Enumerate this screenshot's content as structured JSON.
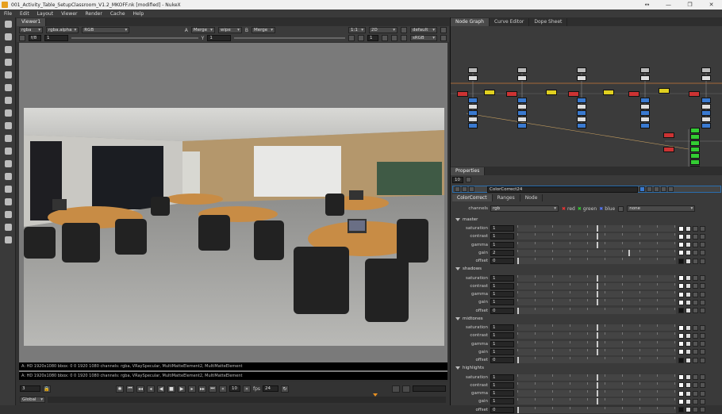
{
  "window": {
    "title": "001_Activity_Table_SetupClassroom_V1.2_MKOFF.nk [modified] - NukeX",
    "controls": [
      "↔",
      "—",
      "❐",
      "✕"
    ]
  },
  "menu": [
    "File",
    "Edit",
    "Layout",
    "Viewer",
    "Render",
    "Cache",
    "Help"
  ],
  "left_tools": [
    "viewer-icon",
    "paint-icon",
    "time-icon",
    "channel-icon",
    "color-icon",
    "filter-icon",
    "keyer-icon",
    "merge-icon",
    "transform-icon",
    "3d-icon",
    "particles-icon",
    "deep-icon",
    "views-icon",
    "metadata-icon",
    "toolsets-icon",
    "other-icon",
    "cara-icon",
    "smartvector-icon"
  ],
  "viewer": {
    "tab": "Viewer1",
    "bar1": {
      "channels": "rgba",
      "alpha": "rgba.alpha",
      "display": "RGB",
      "a_label": "A",
      "a_merge": "Merge",
      "wipe": "wipe",
      "b_label": "B",
      "b_merge": "Merge"
    },
    "bar1_right": {
      "zoom": "1:1",
      "mode": "2D",
      "view": "default"
    },
    "bar2": {
      "fstop": "f/8",
      "fstop_val": "1",
      "y_label": "Y",
      "gamma": "1"
    },
    "bar2_right": {
      "proxy": "1",
      "lut": "sRGB"
    },
    "info1": "A: HD 1920x1080 bbox: 0 0 1920 1080 channels: rgba, VRaySpecular, MultiMatteElement2, MultiMatteElement",
    "info2": "A: HD 1920x1080 bbox: 0 0 1920 1080 channels: rgba, VRaySpecular, MultiMatteElement2, MultiMatteElement",
    "frame": "3",
    "fps_label": "fps",
    "fps": "24",
    "step": "10",
    "range": "Global"
  },
  "nodegraph": {
    "tabs": [
      "Node Graph",
      "Curve Editor",
      "Dope Sheet"
    ]
  },
  "properties": {
    "tab": "Properties",
    "count": "10",
    "node_name": "ColorCorrect24",
    "subtabs": [
      "ColorCorrect",
      "Ranges",
      "Node"
    ],
    "channels_label": "channels",
    "channels_val": "rgb",
    "ch_red": "red",
    "ch_green": "green",
    "ch_blue": "blue",
    "ch_none": "none",
    "sections": [
      {
        "name": "master",
        "rows": [
          {
            "label": "saturation",
            "value": "1"
          },
          {
            "label": "contrast",
            "value": "1"
          },
          {
            "label": "gamma",
            "value": "1"
          },
          {
            "label": "gain",
            "value": "2"
          },
          {
            "label": "offset",
            "value": "0"
          }
        ]
      },
      {
        "name": "shadows",
        "rows": [
          {
            "label": "saturation",
            "value": "1"
          },
          {
            "label": "contrast",
            "value": "1"
          },
          {
            "label": "gamma",
            "value": "1"
          },
          {
            "label": "gain",
            "value": "1"
          },
          {
            "label": "offset",
            "value": "0"
          }
        ]
      },
      {
        "name": "midtones",
        "rows": [
          {
            "label": "saturation",
            "value": "1"
          },
          {
            "label": "contrast",
            "value": "1"
          },
          {
            "label": "gamma",
            "value": "1"
          },
          {
            "label": "gain",
            "value": "1"
          },
          {
            "label": "offset",
            "value": "0"
          }
        ]
      },
      {
        "name": "highlights",
        "rows": [
          {
            "label": "saturation",
            "value": "1"
          },
          {
            "label": "contrast",
            "value": "1"
          },
          {
            "label": "gamma",
            "value": "1"
          },
          {
            "label": "gain",
            "value": "1"
          },
          {
            "label": "offset",
            "value": "0"
          }
        ]
      }
    ]
  }
}
